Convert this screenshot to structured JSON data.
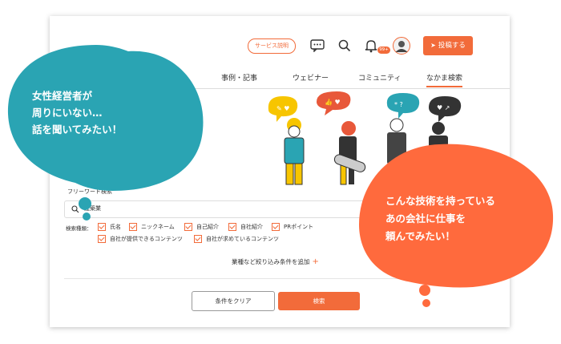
{
  "header": {
    "service_pill": "サービス説明",
    "notification_count": "99+",
    "post_button": "投稿する"
  },
  "tabs": [
    {
      "label": "事例・記事"
    },
    {
      "label": "ウェビナー"
    },
    {
      "label": "コミュニティ"
    },
    {
      "label": "なかま検索"
    }
  ],
  "search": {
    "keyword_label": "フリーワード検索",
    "keyword_value": "建築業",
    "types_label": "検索種類：",
    "checkboxes": [
      {
        "label": "氏名",
        "checked": true
      },
      {
        "label": "ニックネーム",
        "checked": true
      },
      {
        "label": "自己紹介",
        "checked": true
      },
      {
        "label": "自社紹介",
        "checked": true
      },
      {
        "label": "PRポイント",
        "checked": true
      },
      {
        "label": "自社が提供できるコンテンツ",
        "checked": true
      },
      {
        "label": "自社が求めているコンテンツ",
        "checked": true
      }
    ],
    "narrow_label": "業種など絞り込み条件を追加",
    "clear_button": "条件をクリア",
    "search_button": "検索"
  },
  "bubbles": {
    "left_lines": [
      "女性経営者が",
      "周りにいない…",
      "話を聞いてみたい！"
    ],
    "right_lines": [
      "こんな技術を持っている",
      "あの会社に仕事を",
      "頼んでみたい！"
    ]
  },
  "colors": {
    "accent": "#f26b3a",
    "teal": "#2aa4b3",
    "orange_bubble": "#ff6a3d"
  }
}
